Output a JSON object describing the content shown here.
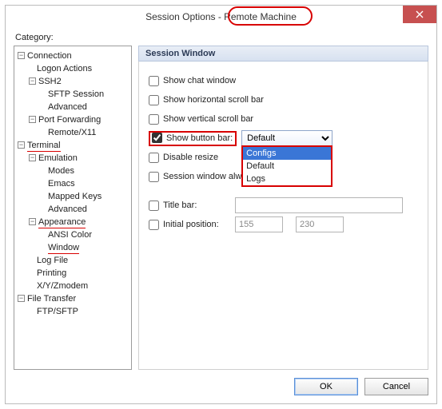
{
  "title_prefix": "Session Options - ",
  "title_machine": "Remote Machine",
  "category_label": "Category:",
  "tree": {
    "connection": "Connection",
    "logon_actions": "Logon Actions",
    "ssh2": "SSH2",
    "sftp_session": "SFTP Session",
    "advanced": "Advanced",
    "port_forwarding": "Port Forwarding",
    "remote_x11": "Remote/X11",
    "terminal": "Terminal",
    "emulation": "Emulation",
    "modes": "Modes",
    "emacs": "Emacs",
    "mapped_keys": "Mapped Keys",
    "advanced2": "Advanced",
    "appearance": "Appearance",
    "ansi_color": "ANSI Color",
    "window": "Window",
    "log_file": "Log File",
    "printing": "Printing",
    "xy_zmodem": "X/Y/Zmodem",
    "file_transfer": "File Transfer",
    "ftp_sftp": "FTP/SFTP"
  },
  "panel_title": "Session Window",
  "checks": {
    "chat": "Show chat window",
    "hscroll": "Show horizontal scroll bar",
    "vscroll": "Show vertical scroll bar",
    "buttonbar": "Show button bar:",
    "disable_resize": "Disable resize",
    "always_on_top": "Session window alwa",
    "titlebar": "Title bar:",
    "initpos": "Initial position:"
  },
  "combo_selected": "Default",
  "dropdown": {
    "opt1": "Configs",
    "opt2": "Default",
    "opt3": "Logs"
  },
  "initpos_x": "155",
  "initpos_y": "230",
  "buttons": {
    "ok": "OK",
    "cancel": "Cancel"
  }
}
